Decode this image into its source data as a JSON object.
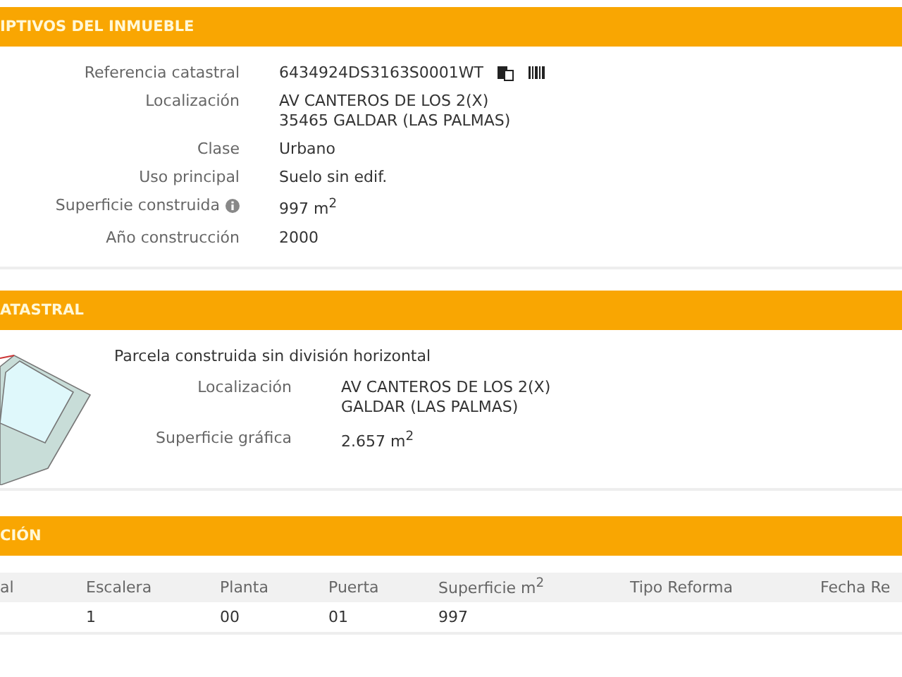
{
  "sections": [
    {
      "kind": "fields",
      "title": "IPTIVOS DEL INMUEBLE",
      "rows": [
        {
          "label": "Referencia catastral",
          "lines": [
            "6434924DS3163S0001WT"
          ],
          "icons": true
        },
        {
          "label": "Localización",
          "lines": [
            "AV CANTEROS DE LOS 2(X)",
            "35465 GALDAR (LAS PALMAS)"
          ]
        },
        {
          "label": "Clase",
          "lines": [
            "Urbano"
          ]
        },
        {
          "label": "Uso principal",
          "lines": [
            "Suelo sin edif."
          ]
        },
        {
          "label": "Superficie construida",
          "lines": [
            "997 m$^{2}$"
          ],
          "info": true
        },
        {
          "label": "Año construcción",
          "lines": [
            "2000"
          ]
        }
      ]
    },
    {
      "kind": "parcel",
      "title": "ATASTRAL",
      "heading": "Parcela construida sin división horizontal",
      "rows": [
        {
          "label": "Localización",
          "lines": [
            "AV CANTEROS DE LOS 2(X)",
            "GALDAR (LAS PALMAS)"
          ]
        },
        {
          "label": "Superficie gráfica",
          "lines": [
            "2.657 m$^{2}$"
          ]
        }
      ]
    },
    {
      "kind": "table",
      "title": "CIÓN",
      "columns": [
        "al",
        "Escalera",
        "Planta",
        "Puerta",
        "Superficie m$^{2}$",
        "Tipo Reforma",
        "Fecha Re"
      ],
      "rows": [
        [
          "",
          "1",
          "00",
          "01",
          "997",
          "",
          ""
        ]
      ]
    }
  ]
}
